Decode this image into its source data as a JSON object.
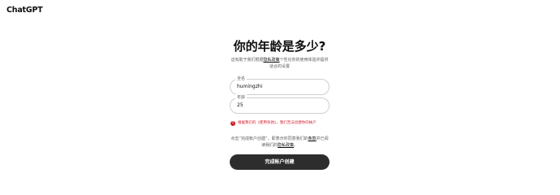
{
  "header": {
    "brand": "ChatGPT"
  },
  "form": {
    "title": "你的年龄是多少?",
    "subtitle_before": "这有助于我们根据",
    "subtitle_link": "隐私政策",
    "subtitle_after": "个性化你的使用体验并提供适合的设置",
    "name_field": {
      "label": "全名",
      "value": "humingzhi"
    },
    "age_field": {
      "label": "年龄",
      "value": "25"
    },
    "error_message": "根据我们的《使用条款》，我们无法创建你的帐户",
    "terms_before": "点击“完成帐户创建”，即表示你同意我们的",
    "terms_link1": "条款",
    "terms_middle": "并已阅读我们的",
    "terms_link2": "隐私政策",
    "terms_after": "。",
    "submit_label": "完成帐户创建"
  },
  "colors": {
    "error": "#d0212f",
    "button_bg": "#2d2d2d",
    "border": "#cfcfcf"
  },
  "icons": {
    "error": "alert-circle-icon"
  }
}
